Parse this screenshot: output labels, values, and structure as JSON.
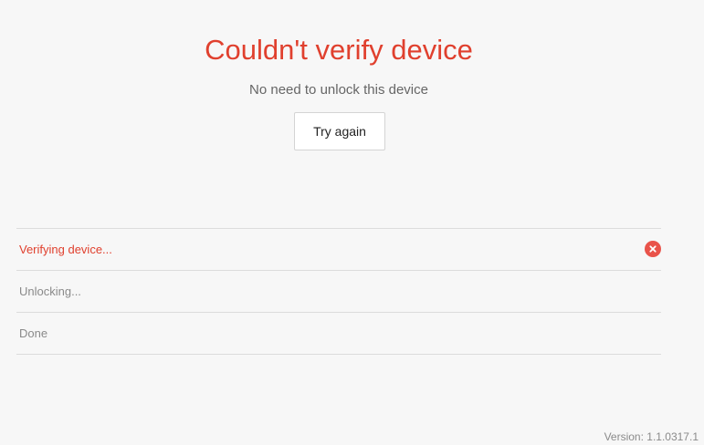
{
  "header": {
    "title": "Couldn't verify device",
    "subtitle": "No need to unlock this device",
    "retry_label": "Try again"
  },
  "steps": [
    {
      "label": "Verifying device...",
      "status": "error",
      "icon": "error-x-icon"
    },
    {
      "label": "Unlocking...",
      "status": "pending"
    },
    {
      "label": "Done",
      "status": "pending"
    }
  ],
  "footer": {
    "version": "Version: 1.1.0317.1"
  },
  "colors": {
    "error": "#e0402e",
    "muted": "#8a8a8a",
    "background": "#f7f7f7"
  }
}
